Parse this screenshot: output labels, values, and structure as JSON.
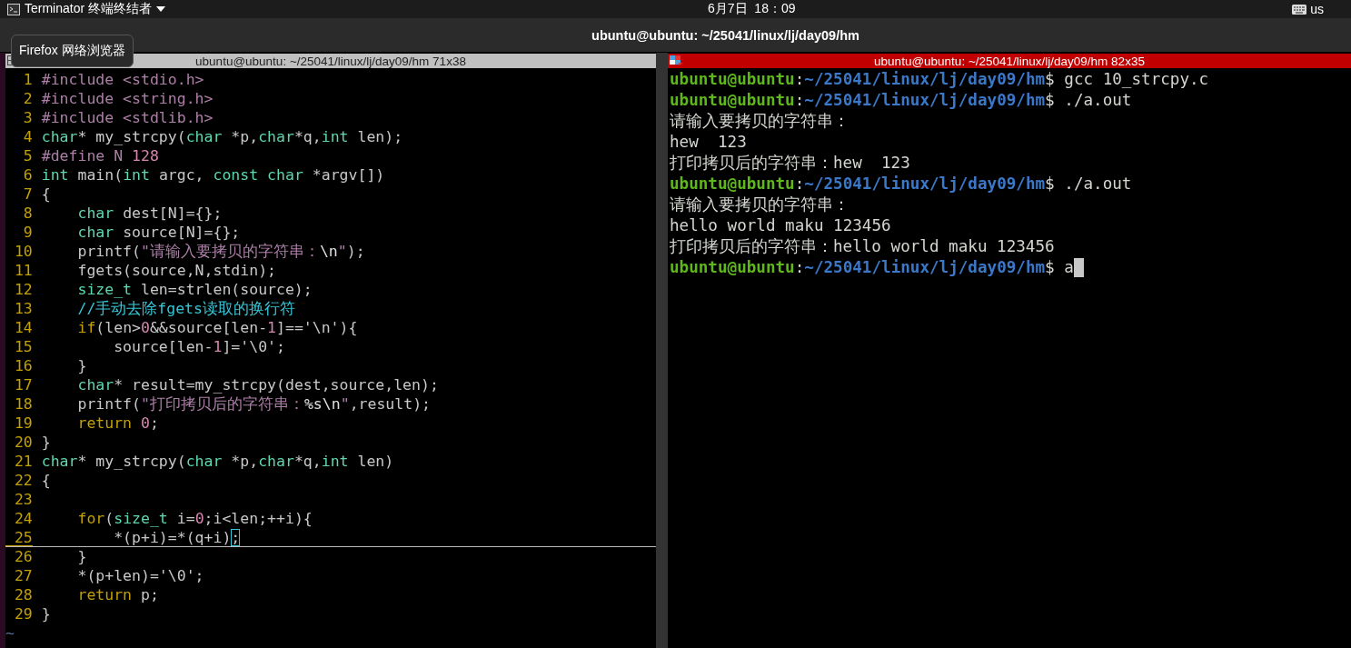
{
  "top_bar": {
    "app_menu": "Terminator 终端终结者",
    "clock": "6月7日  18：09",
    "keyboard_layout": "us"
  },
  "tooltip": "Firefox 网络浏览器",
  "window": {
    "title": "ubuntu@ubuntu: ~/25041/linux/lj/day09/hm"
  },
  "panes": [
    {
      "kind": "editor",
      "title": "ubuntu@ubuntu: ~/25041/linux/lj/day09/hm 71x38",
      "focused": false,
      "filler": "~",
      "lines": [
        {
          "number": "1",
          "current": false,
          "tokens": [
            {
              "text": "#include <stdio.h>",
              "color": "#ad7fa8"
            }
          ]
        },
        {
          "number": "2",
          "current": false,
          "tokens": [
            {
              "text": "#include <string.h>",
              "color": "#ad7fa8"
            }
          ]
        },
        {
          "number": "3",
          "current": false,
          "tokens": [
            {
              "text": "#include <stdlib.h>",
              "color": "#ad7fa8"
            }
          ]
        },
        {
          "number": "4",
          "current": false,
          "tokens": [
            {
              "text": "char",
              "color": "#5fd7af"
            },
            {
              "text": "* my_strcpy(",
              "color": "#c8c8c8"
            },
            {
              "text": "char",
              "color": "#5fd7af"
            },
            {
              "text": " *p,",
              "color": "#c8c8c8"
            },
            {
              "text": "char",
              "color": "#5fd7af"
            },
            {
              "text": "*q,",
              "color": "#c8c8c8"
            },
            {
              "text": "int",
              "color": "#5fd7af"
            },
            {
              "text": " len);",
              "color": "#c8c8c8"
            }
          ]
        },
        {
          "number": "5",
          "current": false,
          "tokens": [
            {
              "text": "#define N ",
              "color": "#ad7fa8"
            },
            {
              "text": "128",
              "color": "#d787af"
            }
          ]
        },
        {
          "number": "6",
          "current": false,
          "tokens": [
            {
              "text": "int",
              "color": "#5fd7af"
            },
            {
              "text": " main(",
              "color": "#c8c8c8"
            },
            {
              "text": "int",
              "color": "#5fd7af"
            },
            {
              "text": " argc, ",
              "color": "#c8c8c8"
            },
            {
              "text": "const char",
              "color": "#5fd7af"
            },
            {
              "text": " *argv[])",
              "color": "#c8c8c8"
            }
          ]
        },
        {
          "number": "7",
          "current": false,
          "tokens": [
            {
              "text": "{",
              "color": "#c8c8c8"
            }
          ]
        },
        {
          "number": "8",
          "current": false,
          "tokens": [
            {
              "text": "    char",
              "color": "#5fd7af"
            },
            {
              "text": " dest[N]={};",
              "color": "#c8c8c8"
            }
          ]
        },
        {
          "number": "9",
          "current": false,
          "tokens": [
            {
              "text": "    char",
              "color": "#5fd7af"
            },
            {
              "text": " source[N]={};",
              "color": "#c8c8c8"
            }
          ]
        },
        {
          "number": "10",
          "current": false,
          "tokens": [
            {
              "text": "    printf(",
              "color": "#c8c8c8"
            },
            {
              "text": "\"请输入要拷贝的字符串：",
              "color": "#ad7fa8"
            },
            {
              "text": "\\n",
              "color": "#e0e0e0"
            },
            {
              "text": "\"",
              "color": "#ad7fa8"
            },
            {
              "text": ");",
              "color": "#c8c8c8"
            }
          ]
        },
        {
          "number": "11",
          "current": false,
          "tokens": [
            {
              "text": "    fgets(source,N,stdin);",
              "color": "#c8c8c8"
            }
          ]
        },
        {
          "number": "12",
          "current": false,
          "tokens": [
            {
              "text": "    size_t",
              "color": "#5fd7af"
            },
            {
              "text": " len=strlen(source);",
              "color": "#c8c8c8"
            }
          ]
        },
        {
          "number": "13",
          "current": false,
          "tokens": [
            {
              "text": "    //手动去除fgets读取的换行符",
              "color": "#34c6d8"
            }
          ]
        },
        {
          "number": "14",
          "current": false,
          "tokens": [
            {
              "text": "    if",
              "color": "#c4a000"
            },
            {
              "text": "(len>",
              "color": "#c8c8c8"
            },
            {
              "text": "0",
              "color": "#d787af"
            },
            {
              "text": "&&source[len-",
              "color": "#c8c8c8"
            },
            {
              "text": "1",
              "color": "#d787af"
            },
            {
              "text": "]=='\\n'){",
              "color": "#c8c8c8"
            }
          ]
        },
        {
          "number": "15",
          "current": false,
          "tokens": [
            {
              "text": "        source[len-",
              "color": "#c8c8c8"
            },
            {
              "text": "1",
              "color": "#d787af"
            },
            {
              "text": "]='\\0';",
              "color": "#c8c8c8"
            }
          ]
        },
        {
          "number": "16",
          "current": false,
          "tokens": [
            {
              "text": "    }",
              "color": "#c8c8c8"
            }
          ]
        },
        {
          "number": "17",
          "current": false,
          "tokens": [
            {
              "text": "    char",
              "color": "#5fd7af"
            },
            {
              "text": "* result=my_strcpy(dest,source,len);",
              "color": "#c8c8c8"
            }
          ]
        },
        {
          "number": "18",
          "current": false,
          "tokens": [
            {
              "text": "    printf(",
              "color": "#c8c8c8"
            },
            {
              "text": "\"打印拷贝后的字符串：",
              "color": "#ad7fa8"
            },
            {
              "text": "%s\\n",
              "color": "#e0e0e0"
            },
            {
              "text": "\"",
              "color": "#ad7fa8"
            },
            {
              "text": ",result);",
              "color": "#c8c8c8"
            }
          ]
        },
        {
          "number": "19",
          "current": false,
          "tokens": [
            {
              "text": "    return",
              "color": "#c4a000"
            },
            {
              "text": " 0",
              "color": "#d787af"
            },
            {
              "text": ";",
              "color": "#c8c8c8"
            }
          ]
        },
        {
          "number": "20",
          "current": false,
          "tokens": [
            {
              "text": "}",
              "color": "#c8c8c8"
            }
          ]
        },
        {
          "number": "21",
          "current": false,
          "tokens": [
            {
              "text": "char",
              "color": "#5fd7af"
            },
            {
              "text": "* my_strcpy(",
              "color": "#c8c8c8"
            },
            {
              "text": "char",
              "color": "#5fd7af"
            },
            {
              "text": " *p,",
              "color": "#c8c8c8"
            },
            {
              "text": "char",
              "color": "#5fd7af"
            },
            {
              "text": "*q,",
              "color": "#c8c8c8"
            },
            {
              "text": "int",
              "color": "#5fd7af"
            },
            {
              "text": " len)",
              "color": "#c8c8c8"
            }
          ]
        },
        {
          "number": "22",
          "current": false,
          "tokens": [
            {
              "text": "{",
              "color": "#c8c8c8"
            }
          ]
        },
        {
          "number": "23",
          "current": false
        },
        {
          "number": "24",
          "current": false,
          "tokens": [
            {
              "text": "    for",
              "color": "#c4a000"
            },
            {
              "text": "(",
              "color": "#c8c8c8"
            },
            {
              "text": "size_t",
              "color": "#5fd7af"
            },
            {
              "text": " i=",
              "color": "#c8c8c8"
            },
            {
              "text": "0",
              "color": "#d787af"
            },
            {
              "text": ";i<len;++i){",
              "color": "#c8c8c8"
            }
          ]
        },
        {
          "number": "25",
          "current": true,
          "tokens": [
            {
              "text": "        *(p+i)=*(q+i)",
              "color": "#c8c8c8"
            },
            {
              "text": ";",
              "color": "#c8c8c8",
              "cursor": true
            }
          ]
        },
        {
          "number": "26",
          "current": false,
          "tokens": [
            {
              "text": "    }",
              "color": "#c8c8c8"
            }
          ]
        },
        {
          "number": "27",
          "current": false,
          "tokens": [
            {
              "text": "    *(p+len)='\\0';",
              "color": "#c8c8c8"
            }
          ]
        },
        {
          "number": "28",
          "current": false,
          "tokens": [
            {
              "text": "    return",
              "color": "#c4a000"
            },
            {
              "text": " p;",
              "color": "#c8c8c8"
            }
          ]
        },
        {
          "number": "29",
          "current": false,
          "tokens": [
            {
              "text": "}",
              "color": "#c8c8c8"
            }
          ]
        }
      ]
    },
    {
      "kind": "shell",
      "title": "ubuntu@ubuntu: ~/25041/linux/lj/day09/hm 82x35",
      "focused": true,
      "lines": [
        {
          "kind": "prompt",
          "user": "ubuntu@ubuntu",
          "separator": ":",
          "path": "~/25041/linux/lj/day09/hm",
          "command": "$ gcc 10_strcpy.c",
          "cursor": false
        },
        {
          "kind": "prompt",
          "user": "ubuntu@ubuntu",
          "separator": ":",
          "path": "~/25041/linux/lj/day09/hm",
          "command": "$ ./a.out",
          "cursor": false
        },
        {
          "kind": "output",
          "text": "请输入要拷贝的字符串："
        },
        {
          "kind": "output",
          "text": "hew  123"
        },
        {
          "kind": "output",
          "text": "打印拷贝后的字符串：hew  123"
        },
        {
          "kind": "prompt",
          "user": "ubuntu@ubuntu",
          "separator": ":",
          "path": "~/25041/linux/lj/day09/hm",
          "command": "$ ./a.out",
          "cursor": false
        },
        {
          "kind": "output",
          "text": "请输入要拷贝的字符串："
        },
        {
          "kind": "output",
          "text": "hello world maku 123456"
        },
        {
          "kind": "output",
          "text": "打印拷贝后的字符串：hello world maku 123456"
        },
        {
          "kind": "prompt",
          "user": "ubuntu@ubuntu",
          "separator": ":",
          "path": "~/25041/linux/lj/day09/hm",
          "command": "$ a",
          "cursor": true
        }
      ]
    }
  ]
}
